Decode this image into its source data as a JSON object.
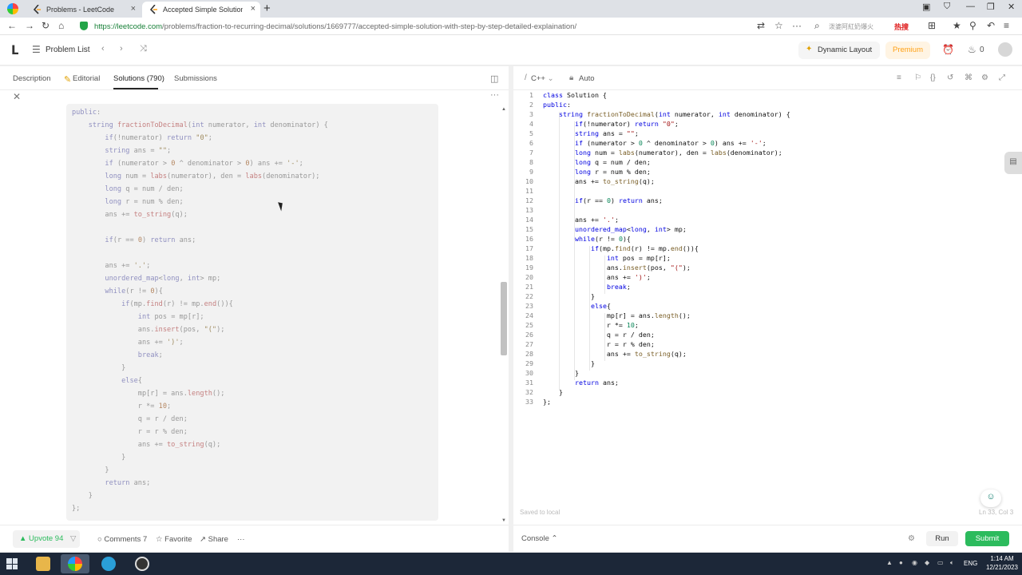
{
  "browser": {
    "tabs": [
      {
        "title": "Problems - LeetCode"
      },
      {
        "title": "Accepted Simple Solution with"
      }
    ],
    "url_host": "https://leetcode.com",
    "url_path": "/problems/fraction-to-recurring-decimal/solutions/1669777/accepted-simple-solution-with-step-by-step-detailed-explaination/",
    "search_placeholder": "泼婆阿紅奶爆火",
    "hot_label": "热搜"
  },
  "header": {
    "problem_list": "Problem List",
    "dynamic_layout": "Dynamic Layout",
    "premium": "Premium",
    "streak_count": "0"
  },
  "left": {
    "tabs": [
      "Description",
      "Editorial",
      "Solutions (790)",
      "Submissions"
    ],
    "code_lines": [
      "public:",
      "    string fractionToDecimal(int numerator, int denominator) {",
      "        if(!numerator) return \"0\";",
      "        string ans = \"\";",
      "        if (numerator > 0 ^ denominator > 0) ans += '-';",
      "        long num = labs(numerator), den = labs(denominator);",
      "        long q = num / den;",
      "        long r = num % den;",
      "        ans += to_string(q);",
      "",
      "        if(r == 0) return ans;",
      "",
      "        ans += '.';",
      "        unordered_map<long, int> mp;",
      "        while(r != 0){",
      "            if(mp.find(r) != mp.end()){",
      "                int pos = mp[r];",
      "                ans.insert(pos, \"(\");",
      "                ans += ')';",
      "                break;",
      "            }",
      "            else{",
      "                mp[r] = ans.length();",
      "                r *= 10;",
      "                q = r / den;",
      "                r = r % den;",
      "                ans += to_string(q);",
      "            }",
      "        }",
      "        return ans;",
      "    }",
      "};"
    ],
    "footer": {
      "upvote": "Upvote 94",
      "comments": "Comments 7",
      "favorite": "Favorite",
      "share": "Share",
      "more": "···"
    }
  },
  "right": {
    "language": "C++",
    "mode": "Auto",
    "code_lines": [
      "class Solution {",
      "public:",
      "    string fractionToDecimal(int numerator, int denominator) {",
      "        if(!numerator) return \"0\";",
      "        string ans = \"\";",
      "        if (numerator > 0 ^ denominator > 0) ans += '-';",
      "        long num = labs(numerator), den = labs(denominator);",
      "        long q = num / den;",
      "        long r = num % den;",
      "        ans += to_string(q);",
      "",
      "        if(r == 0) return ans;",
      "",
      "        ans += '.';",
      "        unordered_map<long, int> mp;",
      "        while(r != 0){",
      "            if(mp.find(r) != mp.end()){",
      "                int pos = mp[r];",
      "                ans.insert(pos, \"(\");",
      "                ans += ')';",
      "                break;",
      "            }",
      "            else{",
      "                mp[r] = ans.length();",
      "                r *= 10;",
      "                q = r / den;",
      "                r = r % den;",
      "                ans += to_string(q);",
      "            }",
      "        }",
      "        return ans;",
      "    }",
      "};"
    ],
    "saved_status": "Saved to local",
    "cursor_position": "Ln 33, Col 3",
    "footer": {
      "console": "Console",
      "run": "Run",
      "submit": "Submit"
    }
  },
  "taskbar": {
    "language": "ENG",
    "time": "1:14 AM",
    "date": "12/21/2023"
  },
  "colors": {
    "accent_green": "#2cbb5d",
    "premium_orange": "#ffa116",
    "keyword_blue": "#0000e0"
  }
}
